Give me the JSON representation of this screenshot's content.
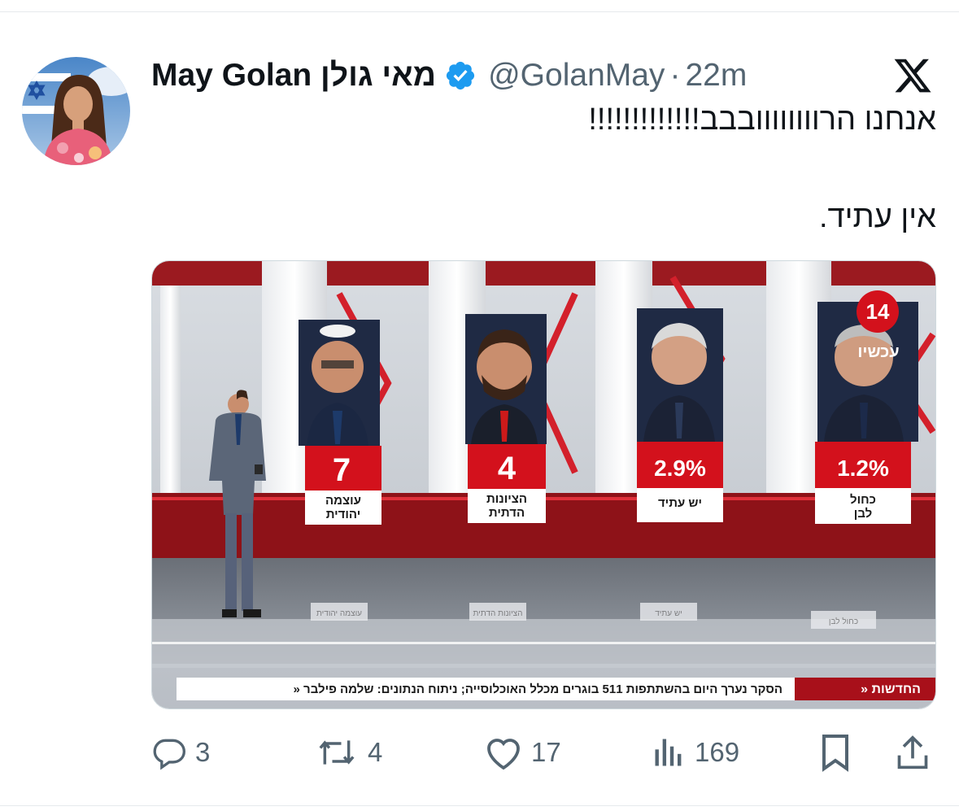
{
  "tweet": {
    "display_name": "May Golan מאי גולן",
    "handle": "@GolanMay",
    "separator": "·",
    "time": "22m",
    "text_line1": "אנחנו הרוווווווובבב!!!!!!!!!!!!!",
    "text_line2": "אין עתיד."
  },
  "media": {
    "parties": [
      {
        "value": "7",
        "name_line1": "עוצמה",
        "name_line2": "יהודית"
      },
      {
        "value": "4",
        "name_line1": "הציונות",
        "name_line2": "הדתית"
      },
      {
        "value": "2.9%",
        "name_line1": "יש עתיד",
        "name_line2": ""
      },
      {
        "value": "1.2%",
        "name_line1": "כחול",
        "name_line2": "לבן"
      }
    ],
    "channel_number": "14",
    "channel_tag": "עכשיו",
    "ticker_brand": "» החדשות",
    "ticker_text": "» הסקר נערך היום בהשתתפות 511 בוגרים מכלל האוכלוסייה; ניתוח הנתונים: שלמה פילבר",
    "floor_labels": [
      "עוצמה יהודית",
      "הציונות הדתית",
      "יש עתיד",
      "כחול לבן"
    ]
  },
  "actions": {
    "replies": "3",
    "reposts": "4",
    "likes": "17",
    "views": "169"
  },
  "colors": {
    "text": "#0f1419",
    "secondary": "#536471",
    "verified": "#1d9bf0",
    "studio_red": "#c8141e"
  },
  "icons": [
    "verified-badge-icon",
    "x-logo-icon",
    "reply-icon",
    "repost-icon",
    "like-icon",
    "views-icon",
    "bookmark-icon",
    "share-icon"
  ]
}
